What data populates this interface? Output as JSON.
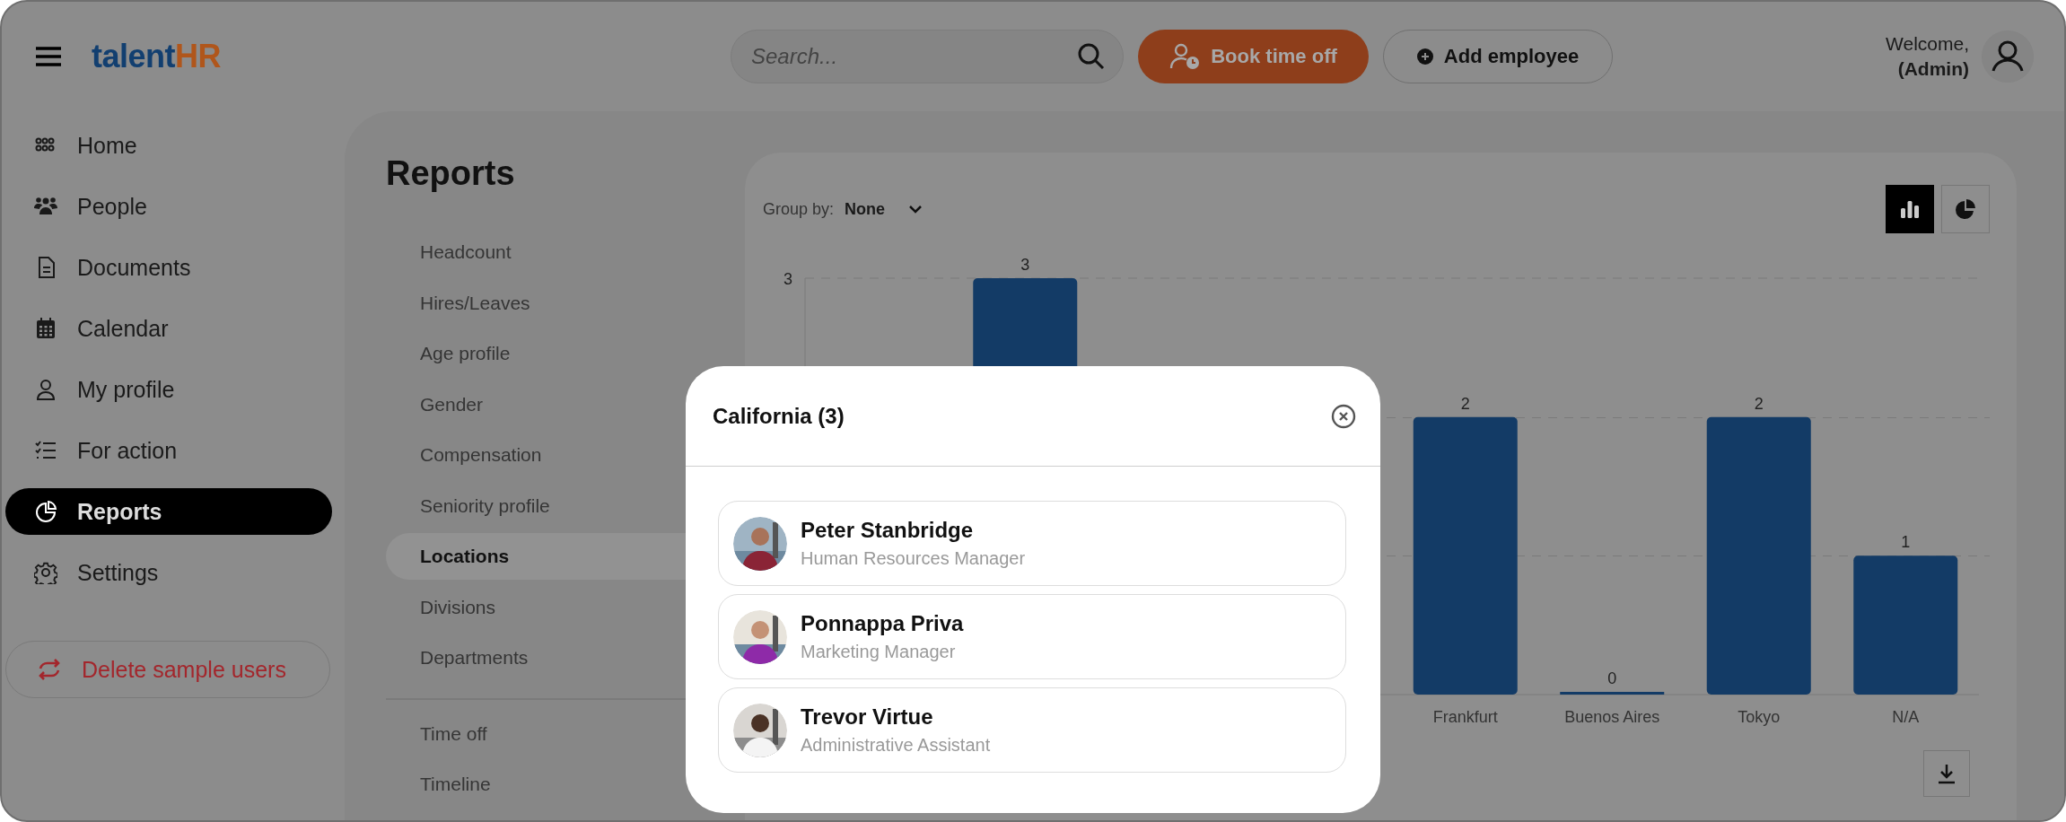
{
  "header": {
    "logo": {
      "text": "talent",
      "accent": "HR"
    },
    "search": {
      "placeholder": "Search..."
    },
    "buttons": [
      {
        "kind": "primary",
        "label": "Book time off"
      },
      {
        "kind": "outline",
        "label": "Add employee"
      }
    ],
    "welcome": "Welcome,",
    "role": "(Admin)"
  },
  "sidebar": {
    "items": [
      {
        "label": "Home",
        "selected": false
      },
      {
        "label": "People",
        "selected": false
      },
      {
        "label": "Documents",
        "selected": false
      },
      {
        "label": "Calendar",
        "selected": false
      },
      {
        "label": "My profile",
        "selected": false
      },
      {
        "label": "For action",
        "selected": false
      },
      {
        "label": "Reports",
        "selected": true
      },
      {
        "label": "Settings",
        "selected": false
      }
    ],
    "action": "Delete sample users"
  },
  "reports": {
    "title": "Reports",
    "items": [
      {
        "label": "Headcount",
        "selected": false
      },
      {
        "label": "Hires/Leaves",
        "selected": false
      },
      {
        "label": "Age profile",
        "selected": false
      },
      {
        "label": "Gender",
        "selected": false
      },
      {
        "label": "Compensation",
        "selected": false
      },
      {
        "label": "Seniority profile",
        "selected": false
      },
      {
        "label": "Locations",
        "selected": true
      },
      {
        "label": "Divisions",
        "selected": false
      },
      {
        "label": "Departments",
        "selected": false
      }
    ],
    "extra_items": [
      {
        "label": "Time off",
        "selected": false
      },
      {
        "label": "Timeline",
        "selected": false
      }
    ]
  },
  "chart_card": {
    "group_by_label": "Group by:",
    "group_by_value": "None",
    "view_toggle": [
      {
        "selected": true
      },
      {
        "selected": false
      }
    ],
    "chart_data": {
      "type": "bar",
      "categories": [
        null,
        null,
        null,
        null,
        "Frankfurt",
        "Buenos Aires",
        "Tokyo",
        "N/A"
      ],
      "values": [
        null,
        3,
        null,
        null,
        2,
        0,
        2,
        1
      ],
      "ylim": [
        0,
        3
      ],
      "yticks": [
        3
      ],
      "data_labels": true
    }
  },
  "modal": {
    "title": "California (3)",
    "people": [
      {
        "name": "Peter Stanbridge",
        "role": "Human Resources Manager"
      },
      {
        "name": "Ponnappa Priva",
        "role": "Marketing Manager"
      },
      {
        "name": "Trevor Virtue",
        "role": "Administrative Assistant"
      }
    ]
  }
}
